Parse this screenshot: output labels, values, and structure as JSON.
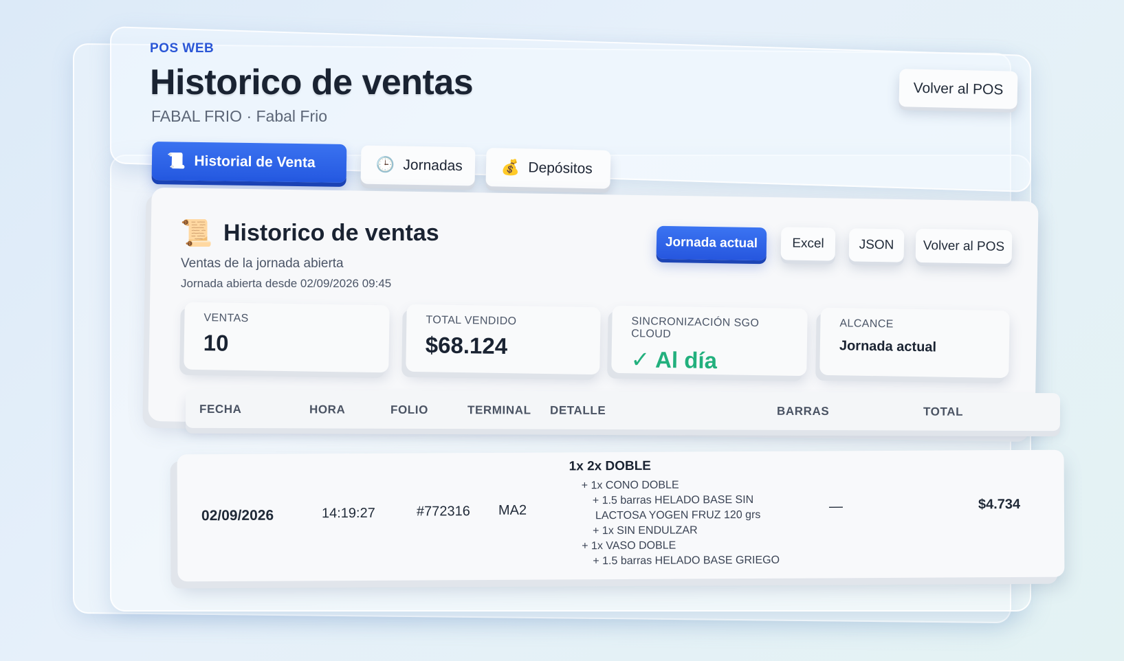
{
  "header": {
    "eyebrow": "POS WEB",
    "title": "Historico de ventas",
    "subtitle": "FABAL FRIO · Fabal Frio",
    "back_button": "Volver al POS"
  },
  "tabs": [
    {
      "label": "Historial de Venta",
      "icon": "scroll-icon",
      "glyph": "📜",
      "active": true
    },
    {
      "label": "Jornadas",
      "icon": "clock-icon",
      "glyph": "🕒",
      "active": false
    },
    {
      "label": "Depósitos",
      "icon": "money-bag-icon",
      "glyph": "💰",
      "active": false
    }
  ],
  "card": {
    "icon_glyph": "📜",
    "title": "Historico de ventas",
    "subtitle": "Ventas de la jornada abierta",
    "jornada_info": "Jornada abierta desde 02/09/2026 09:45",
    "actions": {
      "jornada": "Jornada actual",
      "excel": "Excel",
      "json": "JSON",
      "back": "Volver al POS"
    }
  },
  "stats": [
    {
      "label": "VENTAS",
      "value": "10"
    },
    {
      "label": "TOTAL VENDIDO",
      "value": "$68.124"
    },
    {
      "label": "SINCRONIZACIÓN SGO CLOUD",
      "value": "✓ Al día"
    },
    {
      "label": "ALCANCE",
      "value": "Jornada actual"
    }
  ],
  "table": {
    "columns": [
      "FECHA",
      "HORA",
      "FOLIO",
      "TERMINAL",
      "DETALLE",
      "BARRAS",
      "TOTAL"
    ],
    "rows": [
      {
        "fecha": "02/09/2026",
        "hora": "14:19:27",
        "folio": "#772316",
        "terminal": "MA2",
        "detalle": {
          "main": "1x 2x DOBLE",
          "lines": [
            "+ 1x CONO DOBLE",
            "+ 1.5 barras HELADO BASE SIN",
            "LACTOSA YOGEN FRUZ 120 grs",
            "+ 1x SIN ENDULZAR",
            "+ 1x VASO DOBLE",
            "+ 1.5 barras HELADO BASE GRIEGO"
          ]
        },
        "barras": "—",
        "total": "$4.734"
      }
    ]
  },
  "colors": {
    "accent": "#2a5ee6",
    "success": "#22b07d",
    "eyebrow": "#2a56d6"
  }
}
